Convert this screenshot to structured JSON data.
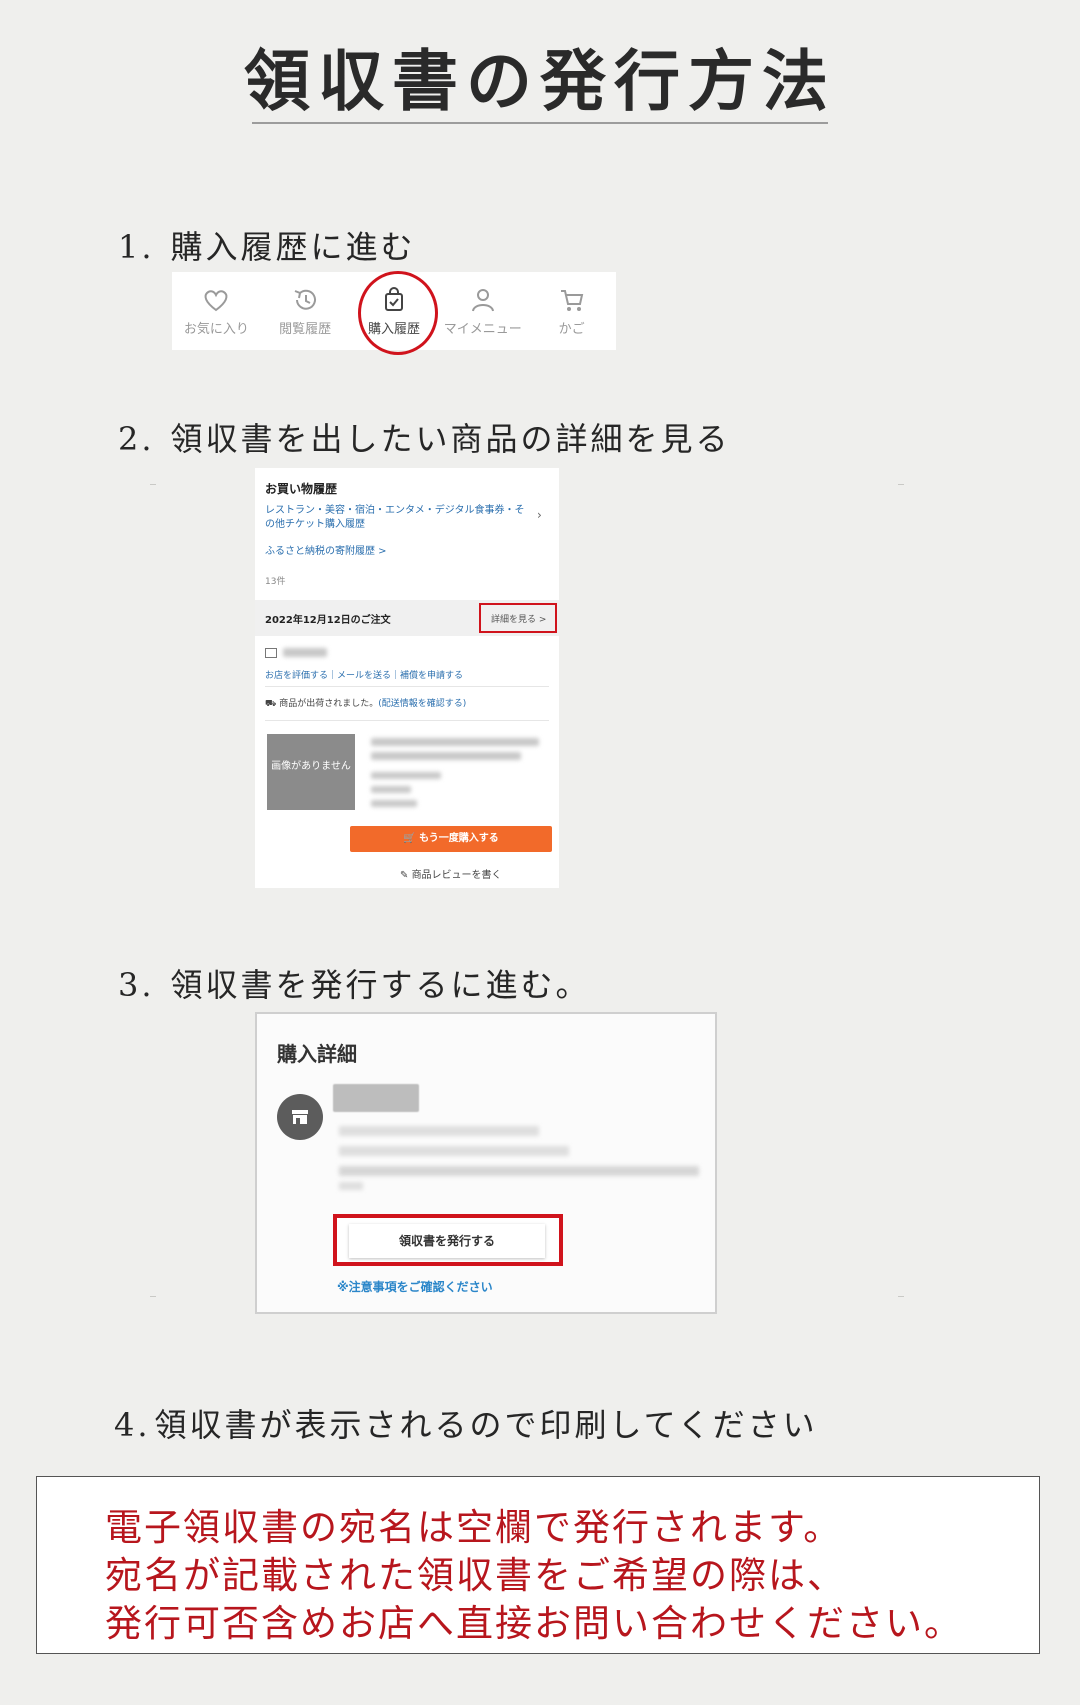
{
  "title": "領収書の発行方法",
  "steps": [
    {
      "num": "1.",
      "text": "購入履歴に進む"
    },
    {
      "num": "2.",
      "text": "領収書を出したい商品の詳細を見る"
    },
    {
      "num": "3.",
      "text": "領収書を発行するに進む。"
    },
    {
      "num": "4.",
      "text": "領収書が表示されるので印刷してください"
    }
  ],
  "navbar": {
    "items": [
      {
        "label": "お気に入り",
        "icon": "heart-icon"
      },
      {
        "label": "閲覧履歴",
        "icon": "history-icon"
      },
      {
        "label": "購入履歴",
        "icon": "shopping-bag-icon",
        "active": true
      },
      {
        "label": "マイメニュー",
        "icon": "person-icon"
      },
      {
        "label": "かご",
        "icon": "cart-icon"
      }
    ],
    "highlight_color": "#d0131c"
  },
  "purchase_history": {
    "heading": "お買い物履歴",
    "other_tickets_link": "レストラン・美容・宿泊・エンタメ・デジタル食事券・その他チケット購入履歴",
    "furusato_link": "ふるさと納税の寄附履歴 >",
    "count": "13件",
    "order_date": "2022年12月12日のご注文",
    "detail_button": "詳細を見る >",
    "shop_links": "お店を評価する｜メールを送る｜補償を申請する",
    "shipping_text": "商品が出荷されました。",
    "shipping_link": "(配送情報を確認する)",
    "no_image_text": "画像がありません",
    "rebuy_button": "もう一度購入する",
    "review_link": "商品レビューを書く"
  },
  "purchase_detail": {
    "heading": "購入詳細",
    "issue_button": "領収書を発行する",
    "note_link": "※注意事項をご確認ください"
  },
  "notice": {
    "lines": [
      "電子領収書の宛名は空欄で発行されます。",
      "宛名が記載された領収書をご希望の際は、",
      "発行可否含めお店へ直接お問い合わせください。"
    ],
    "color": "#b7161d"
  }
}
